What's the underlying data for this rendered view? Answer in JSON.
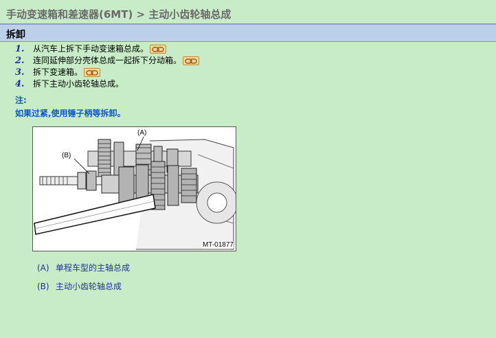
{
  "header": {
    "breadcrumb": "手动变速箱和差速器(6MT) > 主动小齿轮轴总成"
  },
  "section": {
    "title": "拆卸"
  },
  "steps": [
    {
      "num": "1.",
      "text": "从汽车上拆下手动变速箱总成。",
      "has_link": true
    },
    {
      "num": "2.",
      "text": "连同延伸部分壳体总成一起拆下分动箱。",
      "has_link": true
    },
    {
      "num": "3.",
      "text": "拆下变速箱。",
      "has_link": true
    },
    {
      "num": "4.",
      "text": "拆下主动小齿轮轴总成。",
      "has_link": false
    }
  ],
  "note": {
    "label": "注:",
    "text": "如果过紧,使用锤子柄等拆卸。"
  },
  "figure": {
    "callout_a": "(A)",
    "callout_b": "(B)",
    "code": "MT-01877"
  },
  "legend": [
    {
      "key": "(A)",
      "text": "单程车型的主轴总成"
    },
    {
      "key": "(B)",
      "text": "主动小齿轮轴总成"
    }
  ],
  "icons": {
    "reference_link": "chain-link-icon"
  },
  "colors": {
    "background": "#c8ecc8",
    "section_bar": "#bdd0ea",
    "note": "#0d57c4",
    "step_number": "#1f2f9a"
  }
}
